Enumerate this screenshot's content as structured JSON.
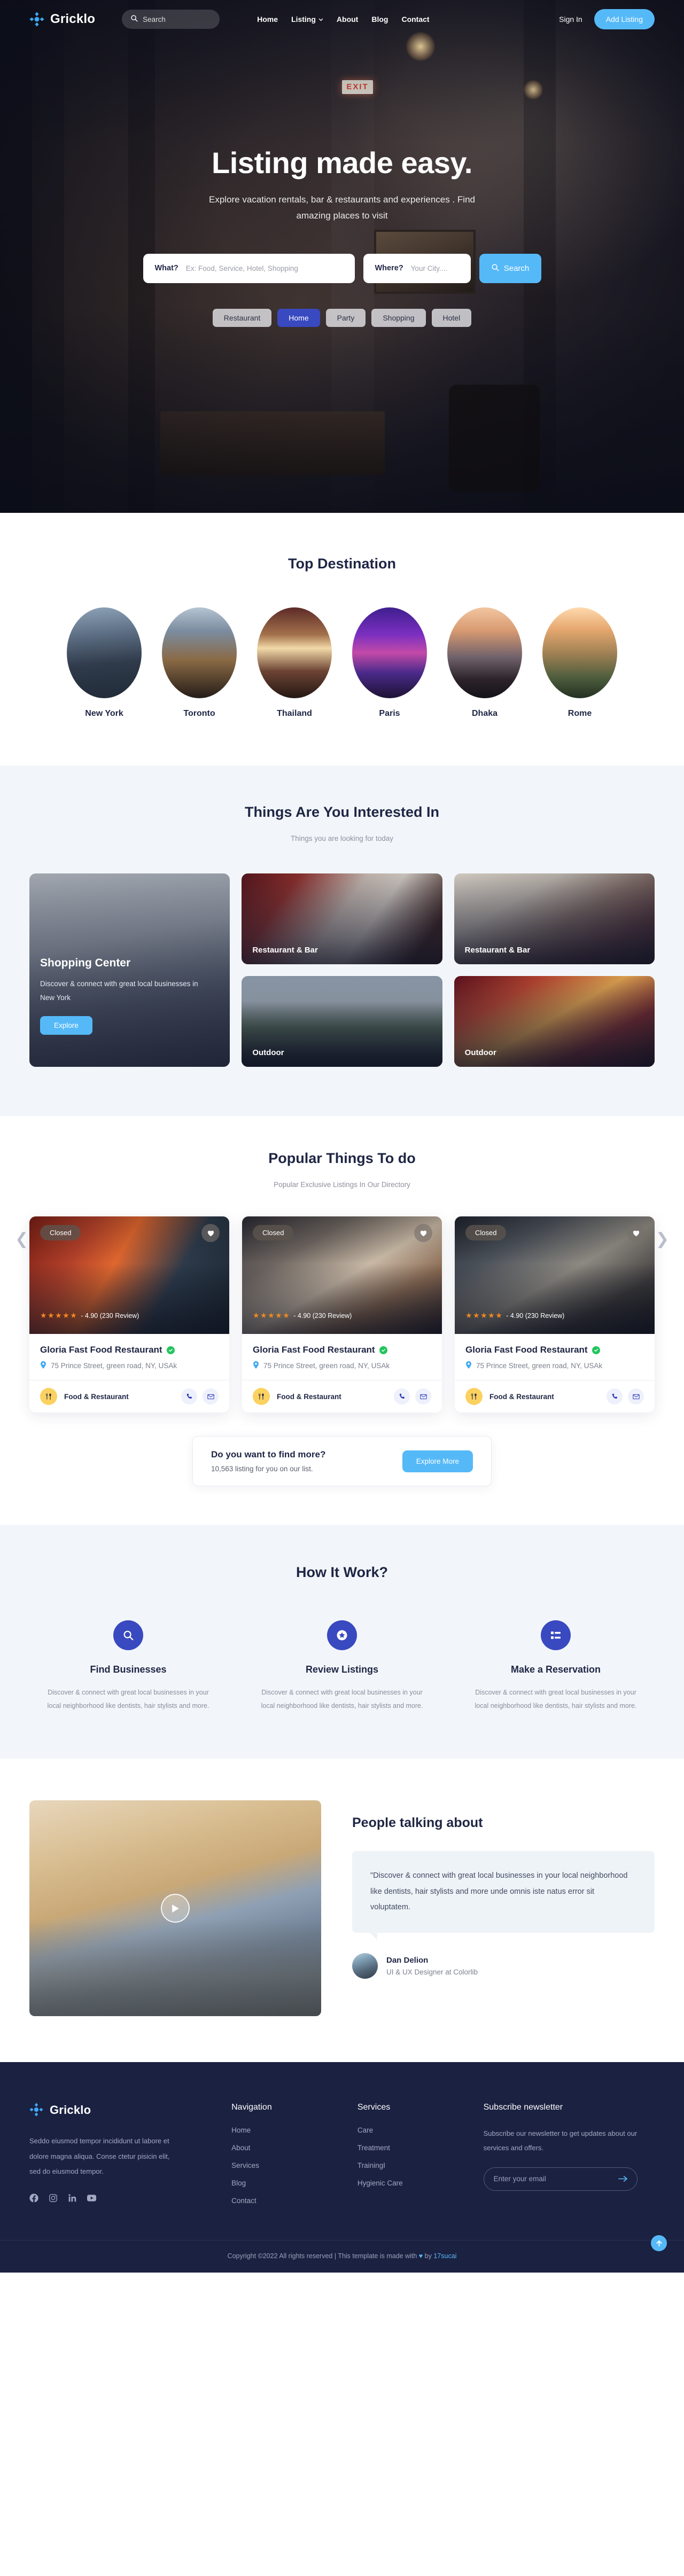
{
  "brand": {
    "name": "Gricklo",
    "logo_icon": "diamond-compass-icon"
  },
  "nav": {
    "search_placeholder": "Search",
    "search_value": "",
    "search_icon": "search-icon",
    "links": [
      {
        "label": "Home",
        "has_caret": false
      },
      {
        "label": "Listing",
        "has_caret": true
      },
      {
        "label": "About",
        "has_caret": false
      },
      {
        "label": "Blog",
        "has_caret": false
      },
      {
        "label": "Contact",
        "has_caret": false
      }
    ],
    "sign_in": "Sign In",
    "add_listing": "Add Listing"
  },
  "hero": {
    "title": "Listing made easy.",
    "subtitle": "Explore vacation rentals, bar & restaurants and experiences . Find amazing places to visit",
    "what_label": "What?",
    "what_placeholder": "Ex: Food, Service, Hotel, Shopping",
    "what_value": "",
    "where_label": "Where?",
    "where_placeholder": "Your City....",
    "where_value": "",
    "search_button": "Search",
    "search_icon": "search-icon",
    "chips": [
      {
        "label": "Restaurant",
        "active": false
      },
      {
        "label": "Home",
        "active": true
      },
      {
        "label": "Party",
        "active": false
      },
      {
        "label": "Shopping",
        "active": false
      },
      {
        "label": "Hotel",
        "active": false
      }
    ]
  },
  "destinations": {
    "title": "Top Destination",
    "items": [
      {
        "name": "New York"
      },
      {
        "name": "Toronto"
      },
      {
        "name": "Thailand"
      },
      {
        "name": "Paris"
      },
      {
        "name": "Dhaka"
      },
      {
        "name": "Rome"
      }
    ]
  },
  "interested": {
    "title": "Things Are You Interested In",
    "subtitle": "Things you are looking for today",
    "cards": [
      {
        "label": "Restaurant & Bar"
      },
      {
        "label": "Restaurant & Bar"
      },
      {
        "label": "Outdoor"
      },
      {
        "label": "Outdoor"
      }
    ],
    "feature": {
      "title": "Shopping Center",
      "text": "Discover & connect with great local businesses in New York",
      "button": "Explore"
    }
  },
  "popular": {
    "title": "Popular Things To do",
    "subtitle": "Popular Exclusive Listings In Our Directory",
    "prev_icon": "chevron-left-icon",
    "next_icon": "chevron-right-icon",
    "listings": [
      {
        "status": "Closed",
        "stars": "★★★★★",
        "rating_text": "- 4.90 (230 Review)",
        "name": "Gloria Fast Food Restaurant",
        "address": "75 Prince Street, green road, NY, USAk",
        "category": "Food & Restaurant",
        "verified": true
      },
      {
        "status": "Closed",
        "stars": "★★★★★",
        "rating_text": "- 4.90 (230 Review)",
        "name": "Gloria Fast Food Restaurant",
        "address": "75 Prince Street, green road, NY, USAk",
        "category": "Food & Restaurant",
        "verified": true
      },
      {
        "status": "Closed",
        "stars": "★★★★★",
        "rating_text": "- 4.90 (230 Review)",
        "name": "Gloria Fast Food Restaurant",
        "address": "75 Prince Street, green road, NY, USAk",
        "category": "Food & Restaurant",
        "verified": true
      }
    ],
    "find_more": {
      "title": "Do you want to find more?",
      "text": "10,563 listing for you on our list.",
      "button": "Explore More"
    }
  },
  "how_it_work": {
    "title": "How It Work?",
    "steps": [
      {
        "icon": "search-icon",
        "title": "Find Businesses",
        "text": "Discover & connect with great local businesses in your local neighborhood like dentists, hair stylists and more."
      },
      {
        "icon": "star-badge-icon",
        "title": "Review Listings",
        "text": "Discover & connect with great local businesses in your local neighborhood like dentists, hair stylists and more."
      },
      {
        "icon": "list-icon",
        "title": "Make a Reservation",
        "text": "Discover & connect with great local businesses in your local neighborhood like dentists, hair stylists and more."
      }
    ]
  },
  "talking": {
    "title": "People talking about",
    "play_icon": "play-icon",
    "quote": "\"Discover & connect with great local businesses in your local neighborhood like dentists, hair stylists and more unde omnis iste natus error sit voluptatem.",
    "author_name": "Dan Delion",
    "author_role": "UI & UX Designer at Colorlib"
  },
  "footer": {
    "description": "Seddo eiusmod tempor incididunt ut labore et dolore magna aliqua. Conse ctetur pisicin elit, sed do eiusmod tempor.",
    "socials": [
      "facebook-icon",
      "instagram-icon",
      "linkedin-icon",
      "youtube-icon"
    ],
    "columns": [
      {
        "head": "Navigation",
        "links": [
          "Home",
          "About",
          "Services",
          "Blog",
          "Contact"
        ]
      },
      {
        "head": "Services",
        "links": [
          "Care",
          "Treatment",
          "TrainingI",
          "Hygienic Care"
        ]
      }
    ],
    "newsletter": {
      "head": "Subscribe newsletter",
      "text": "Subscribe our newsletter to get updates about our services and offers.",
      "placeholder": "Enter your email",
      "value": "",
      "submit_icon": "arrow-right-icon"
    },
    "copyright_pre": "Copyright ©2022 All rights reserved | This template is made with ",
    "copyright_heart": "♥",
    "copyright_mid": " by ",
    "copyright_link": "17sucai",
    "to_top_icon": "arrow-up-icon"
  }
}
